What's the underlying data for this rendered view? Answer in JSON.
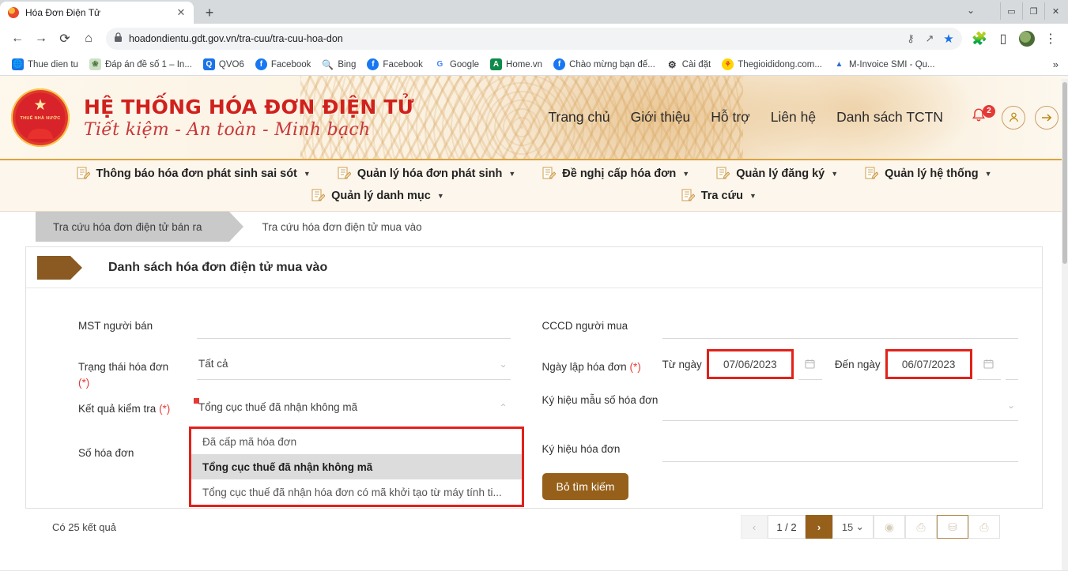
{
  "browser": {
    "tab": {
      "title": "Hóa Đơn Điện Tử",
      "close": "✕",
      "favicon": "site-favicon"
    },
    "new_tab": "+",
    "window_controls": {
      "minimize": "▭",
      "maximize": "❐",
      "close": "✕",
      "chevron": "⌄"
    },
    "nav": {
      "back": "←",
      "forward": "→",
      "reload": "⟳",
      "home": "⌂"
    },
    "omnibox": {
      "lock": "🔒",
      "url": "hoadondientu.gdt.gov.vn/tra-cuu/tra-cuu-hoa-don",
      "key_icon": "⚷",
      "share_icon": "↗",
      "star_icon": "★"
    },
    "toolbar": {
      "extensions": "🧩",
      "sidepanel": "▯",
      "profile": "avatar",
      "menu": "⋮"
    },
    "bookmarks": [
      {
        "label": "Thue dien tu",
        "icon": "globe-icon",
        "color": "#1a73e8",
        "glyph": "🌐"
      },
      {
        "label": "Đáp án đề số 1 – In...",
        "icon": "page-icon",
        "color": "#c8d6c0",
        "glyph": ""
      },
      {
        "label": "QVO6",
        "icon": "qvo6-icon",
        "color": "#1a73e8",
        "glyph": "Q"
      },
      {
        "label": "Facebook",
        "icon": "facebook-icon",
        "color": "#1877f2",
        "glyph": "f"
      },
      {
        "label": "Bing",
        "icon": "bing-icon",
        "color": "#ffffff",
        "glyph": "Q"
      },
      {
        "label": "Facebook",
        "icon": "facebook-icon",
        "color": "#1877f2",
        "glyph": "f"
      },
      {
        "label": "Google",
        "icon": "google-icon",
        "color": "#ffffff",
        "glyph": "G"
      },
      {
        "label": "Home.vn",
        "icon": "home-icon",
        "color": "#0f8a4a",
        "glyph": "A"
      },
      {
        "label": "Chào mừng bạn đế...",
        "icon": "facebook-icon",
        "color": "#1877f2",
        "glyph": "f"
      },
      {
        "label": "Cài đặt",
        "icon": "gear-icon",
        "color": "#ffffff",
        "glyph": "⚙"
      },
      {
        "label": "Thegioididong.com...",
        "icon": "tgdd-icon",
        "color": "#ffd400",
        "glyph": "彡"
      },
      {
        "label": "M-Invoice SMI - Qu...",
        "icon": "minvoice-icon",
        "color": "#ffffff",
        "glyph": "▲"
      }
    ],
    "bookmarks_overflow": "»"
  },
  "banner": {
    "seal_text": "THUẾ NHÀ NƯỚC",
    "star": "★",
    "title": "HỆ THỐNG HÓA ĐƠN ĐIỆN TỬ",
    "slogan": "Tiết kiệm - An toàn - Minh bạch",
    "nav": [
      {
        "label": "Trang chủ"
      },
      {
        "label": "Giới thiệu"
      },
      {
        "label": "Hỗ trợ"
      },
      {
        "label": "Liên hệ"
      },
      {
        "label": "Danh sách TCTN"
      }
    ],
    "notification_count": "2",
    "bell_icon": "bell-icon",
    "user_icon": "user-icon",
    "logout_icon": "arrow-right-icon"
  },
  "menubar": {
    "row1": [
      {
        "label": "Thông báo hóa đơn phát sinh sai sót",
        "caret": "▼"
      },
      {
        "label": "Quản lý hóa đơn phát sinh",
        "caret": "▼"
      },
      {
        "label": "Đề nghị cấp hóa đơn",
        "caret": "▼"
      },
      {
        "label": "Quản lý đăng ký",
        "caret": "▼"
      },
      {
        "label": "Quản lý hệ thống",
        "caret": "▼"
      }
    ],
    "row2": [
      {
        "label": "Quản lý danh mục",
        "caret": "▼"
      },
      {
        "label": "Tra cứu",
        "caret": "▼"
      }
    ]
  },
  "page": {
    "tabs": [
      {
        "label": "Tra cứu hóa đơn điện tử bán ra",
        "active": false
      },
      {
        "label": "Tra cứu hóa đơn điện tử mua vào",
        "active": true
      }
    ],
    "card_title": "Danh sách hóa đơn điện tử mua vào",
    "form": {
      "left": {
        "mst_label": "MST người bán",
        "mst_value": "",
        "mst_placeholder": "",
        "status_label": "Trạng thái hóa đơn",
        "status_required": "(*)",
        "status_value": "Tất cả",
        "check_label": "Kết quả kiểm tra",
        "check_required": "(*)",
        "check_value": "Tổng cục thuế đã nhận không mã",
        "check_chevron": "⌃",
        "invoice_no_label": "Số hóa đơn",
        "invoice_no_value": "",
        "dropdown_options": [
          {
            "label": "Đã cấp mã hóa đơn",
            "selected": false
          },
          {
            "label": "Tổng cục thuế đã nhận không mã",
            "selected": true
          },
          {
            "label": "Tổng cục thuế đã nhận hóa đơn có mã khởi tạo từ máy tính ti...",
            "selected": false
          }
        ]
      },
      "right": {
        "cccd_label": "CCCD người mua",
        "cccd_value": "",
        "date_label": "Ngày lập hóa đơn",
        "date_required": "(*)",
        "from_label": "Từ ngày",
        "from_value": "07/06/2023",
        "to_label": "Đến ngày",
        "to_value": "06/07/2023",
        "calendar_icon": "calendar-icon",
        "form_symbol_label": "Ký hiệu mẫu số hóa đơn",
        "form_symbol_value": "",
        "invoice_symbol_label": "Ký hiệu hóa đơn",
        "invoice_symbol_value": "",
        "clear_button": "Bỏ tìm kiếm"
      }
    },
    "footer": {
      "result_count": "Có 25 kết quả",
      "pager": {
        "prev": "‹",
        "page": "1 / 2",
        "next": "›",
        "page_size": "15",
        "page_size_caret": "⌄",
        "icons": [
          {
            "name": "record-icon",
            "glyph": "◉",
            "selected": false
          },
          {
            "name": "export-pdf-icon",
            "glyph": "⎙",
            "selected": false
          },
          {
            "name": "export-xml-icon",
            "glyph": "⛁",
            "selected": true
          },
          {
            "name": "download-icon",
            "glyph": "⎙",
            "selected": false
          }
        ]
      }
    }
  },
  "colors": {
    "brand_red": "#d0211c",
    "brand_brown": "#96601a",
    "highlight_red": "#e32119",
    "banner_bg": "#fbf2e2",
    "menu_bg": "#fdf6ec"
  }
}
